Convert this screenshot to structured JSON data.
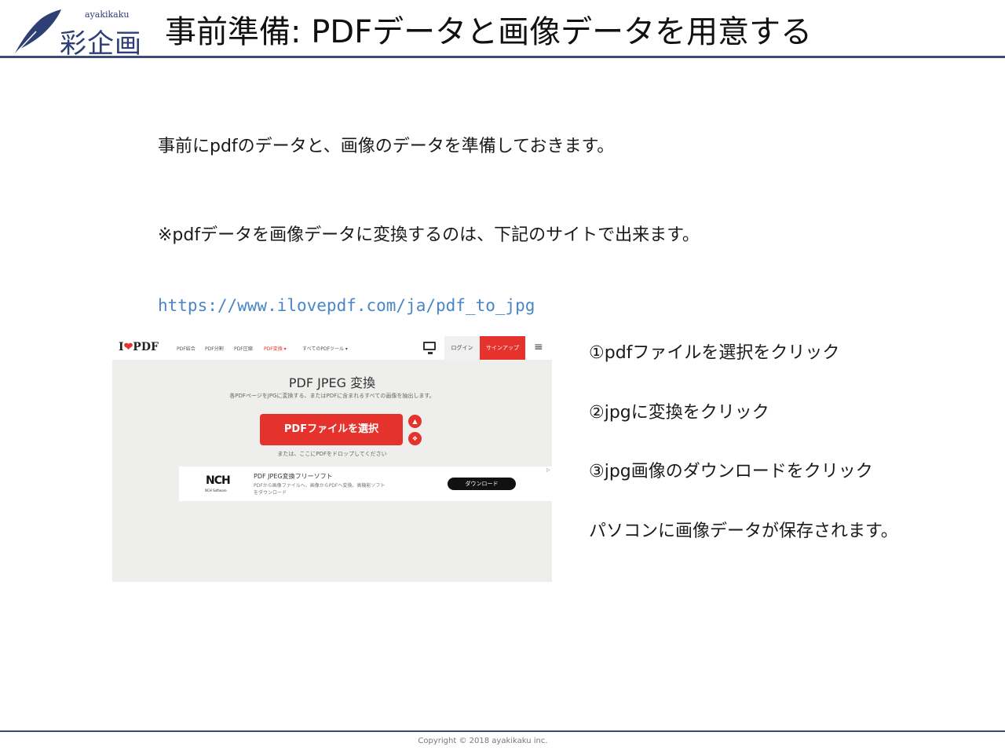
{
  "header": {
    "logo_sub": "ayakikaku",
    "logo_main": "彩企画",
    "title": "事前準備: PDFデータと画像データを用意する"
  },
  "body": {
    "paragraph1": "事前にpdfのデータと、画像のデータを準備しておきます。",
    "paragraph2": "※pdfデータを画像データに変換するのは、下記のサイトで出来ます。",
    "link": "https://www.ilovepdf.com/ja/pdf_to_jpg"
  },
  "screenshot": {
    "brand_i": "I",
    "brand_pdf": "PDF",
    "menu": [
      "PDF結合",
      "PDF分割",
      "PDF圧縮",
      "PDF変換 ▾",
      "すべてのPDFツール ▾"
    ],
    "login": "ログイン",
    "signup": "サインアップ",
    "heading": "PDF JPEG 変換",
    "description": "各PDFページをJPGに変換する、またはPDFに含まれるすべての画像を抽出します。",
    "select_button": "PDFファイルを選択",
    "drop_text": "または、ここにPDFをドロップしてください",
    "ad": {
      "logo": "NCH",
      "logo_sub": "NCH Software",
      "title": "PDF JPEG変換フリーソフト",
      "text": "PDFから画像ファイルへ、画像からPDFへ変換。高機能ソフトをダウンロード",
      "button": "ダウンロード"
    }
  },
  "steps": [
    "①pdfファイルを選択をクリック",
    "②jpgに変換をクリック",
    "③jpg画像のダウンロードをクリック",
    "パソコンに画像データが保存されます。"
  ],
  "footer": "Copyright © 2018 ayakikaku inc.",
  "colors": {
    "brand_navy": "#2d3f74",
    "rule": "#3b4a78",
    "link": "#4a86c7",
    "ilovepdf_red": "#e5322d"
  }
}
